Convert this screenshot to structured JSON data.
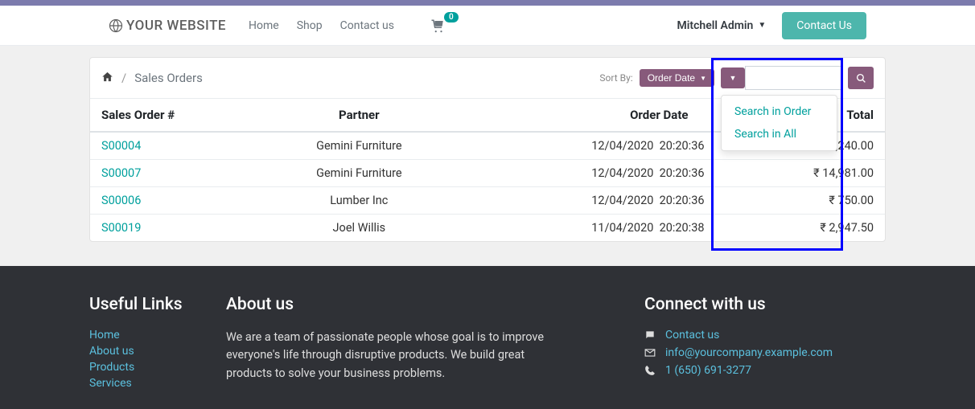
{
  "brand": "YOUR WEBSITE",
  "nav": {
    "home": "Home",
    "shop": "Shop",
    "contact": "Contact us"
  },
  "cart_count": "0",
  "user": "Mitchell Admin",
  "contact_btn": "Contact Us",
  "breadcrumb": "Sales Orders",
  "sort": {
    "label": "Sort By:",
    "value": "Order Date"
  },
  "dropdown": {
    "opt1": "Search in Order",
    "opt2": "Search in All"
  },
  "columns": {
    "c0": "Sales Order #",
    "c1": "Partner",
    "c2": "Order Date",
    "c3": "Total"
  },
  "rows": [
    {
      "so": "S00004",
      "partner": "Gemini Furniture",
      "date": "12/04/2020",
      "time": "20:20:36",
      "total": "₹ 2,240.00"
    },
    {
      "so": "S00007",
      "partner": "Gemini Furniture",
      "date": "12/04/2020",
      "time": "20:20:36",
      "total": "₹ 14,981.00"
    },
    {
      "so": "S00006",
      "partner": "Lumber Inc",
      "date": "12/04/2020",
      "time": "20:20:36",
      "total": "₹ 750.00"
    },
    {
      "so": "S00019",
      "partner": "Joel Willis",
      "date": "11/04/2020",
      "time": "20:20:38",
      "total": "₹ 2,947.50"
    }
  ],
  "footer": {
    "useful_title": "Useful Links",
    "about_title": "About us",
    "connect_title": "Connect with us",
    "links": {
      "home": "Home",
      "about": "About us",
      "products": "Products",
      "services": "Services"
    },
    "about_text": "We are a team of passionate people whose goal is to improve everyone's life through disruptive products. We build great products to solve your business problems.",
    "contact_link": "Contact us",
    "email": "info@yourcompany.example.com",
    "phone": "1 (650) 691-3277"
  }
}
